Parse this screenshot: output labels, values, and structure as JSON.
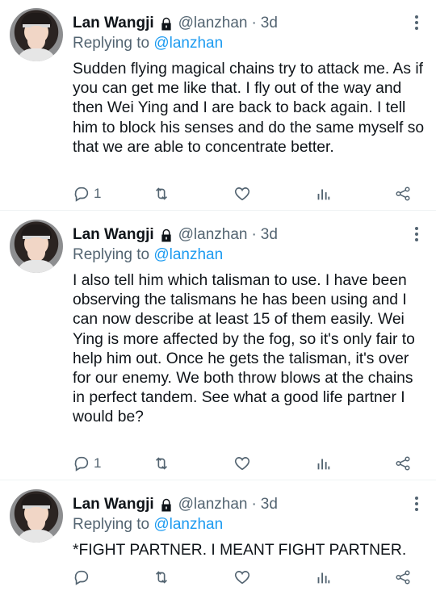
{
  "tweets": [
    {
      "name": "Lan Wangji",
      "handle": "@lanzhan",
      "dot": "·",
      "time": "3d",
      "reply_prefix": "Replying to",
      "reply_to": "@lanzhan",
      "text": "Sudden flying magical chains try to attack me. As if you can get me like that. I fly out of the way and then Wei Ying and I are back to back again. I tell him to block his senses and do the same myself so that we are able to concentrate better.",
      "reply_count": "1"
    },
    {
      "name": "Lan Wangji",
      "handle": "@lanzhan",
      "dot": "·",
      "time": "3d",
      "reply_prefix": "Replying to",
      "reply_to": "@lanzhan",
      "text": "I also tell him which talisman to use. I have been observing the talismans he has been using and I can now describe at least 15 of them easily. Wei Ying is more affected by the fog, so it's only fair to help him out. Once he gets the talisman, it's over for our enemy. We both throw blows at the chains in perfect tandem. See what a good life partner I would be?",
      "reply_count": "1"
    },
    {
      "name": "Lan Wangji",
      "handle": "@lanzhan",
      "dot": "·",
      "time": "3d",
      "reply_prefix": "Replying to",
      "reply_to": "@lanzhan",
      "text": "*FIGHT PARTNER. I MEANT FIGHT PARTNER.",
      "reply_count": ""
    }
  ],
  "icons": {
    "lock": "lock-icon",
    "more": "more-vertical-icon",
    "reply": "reply-icon",
    "retweet": "retweet-icon",
    "like": "heart-icon",
    "views": "analytics-icon",
    "share": "share-icon"
  },
  "colors": {
    "text": "#0f1419",
    "secondary": "#536471",
    "accent": "#1d9bf0"
  }
}
